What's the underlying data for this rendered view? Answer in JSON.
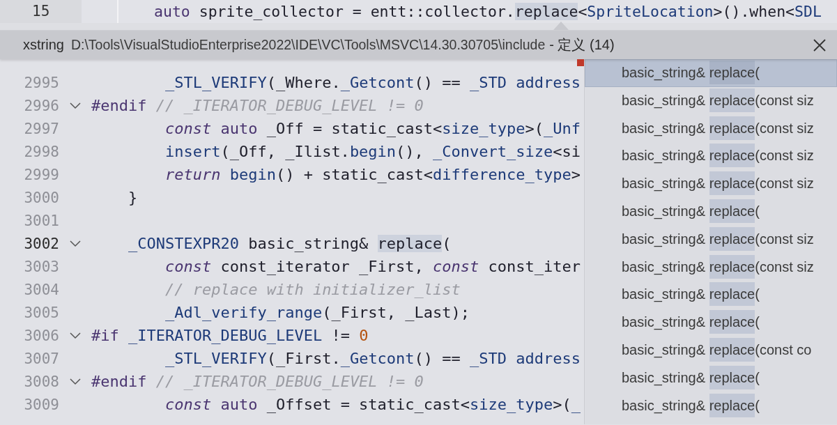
{
  "top_line": {
    "number": "15",
    "tokens": [
      {
        "text": "auto",
        "kind": "kw"
      },
      {
        "text": " sprite_collector = entt::collector.",
        "kind": "p"
      },
      {
        "text": "replace",
        "kind": "hl"
      },
      {
        "text": "<",
        "kind": "p"
      },
      {
        "text": "SpriteLocation",
        "kind": "id"
      },
      {
        "text": ">().when<",
        "kind": "p"
      },
      {
        "text": "SDL",
        "kind": "id"
      }
    ]
  },
  "peek_header": {
    "file_name": "xstring",
    "path": "D:\\Tools\\VisualStudioEnterprise2022\\IDE\\VC\\Tools\\MSVC\\14.30.30705\\include",
    "title": "- 定义 (14)"
  },
  "lines": [
    {
      "number": "2995",
      "fold": false,
      "current": false,
      "tokens": [
        {
          "text": "        _STL_VERIFY",
          "kind": "id"
        },
        {
          "text": "(_Where.",
          "kind": "p"
        },
        {
          "text": "_Getcont",
          "kind": "id"
        },
        {
          "text": "() == ",
          "kind": "p"
        },
        {
          "text": "_STD address",
          "kind": "id"
        }
      ]
    },
    {
      "number": "2996",
      "fold": true,
      "current": false,
      "tokens": [
        {
          "text": "#endif",
          "kind": "pp"
        },
        {
          "text": " // _ITERATOR_DEBUG_LEVEL != 0",
          "kind": "cm"
        }
      ]
    },
    {
      "number": "2997",
      "fold": false,
      "current": false,
      "tokens": [
        {
          "text": "        const",
          "kind": "kwi"
        },
        {
          "text": " auto",
          "kind": "kw"
        },
        {
          "text": " _Off = static_cast<",
          "kind": "p"
        },
        {
          "text": "size_type",
          "kind": "id"
        },
        {
          "text": ">(",
          "kind": "p"
        },
        {
          "text": "_Unf",
          "kind": "id"
        }
      ]
    },
    {
      "number": "2998",
      "fold": false,
      "current": false,
      "tokens": [
        {
          "text": "        insert",
          "kind": "id"
        },
        {
          "text": "(_Off, _Ilist.",
          "kind": "p"
        },
        {
          "text": "begin",
          "kind": "id"
        },
        {
          "text": "(), ",
          "kind": "p"
        },
        {
          "text": "_Convert_size",
          "kind": "id"
        },
        {
          "text": "<si",
          "kind": "p"
        }
      ]
    },
    {
      "number": "2999",
      "fold": false,
      "current": false,
      "tokens": [
        {
          "text": "        return",
          "kind": "kwi"
        },
        {
          "text": " begin",
          "kind": "id"
        },
        {
          "text": "() + static_cast<",
          "kind": "p"
        },
        {
          "text": "difference_type",
          "kind": "id"
        },
        {
          "text": ">",
          "kind": "p"
        }
      ]
    },
    {
      "number": "3000",
      "fold": false,
      "current": false,
      "tokens": [
        {
          "text": "    }",
          "kind": "p"
        }
      ]
    },
    {
      "number": "3001",
      "fold": false,
      "current": false
    },
    {
      "number": "3002",
      "fold": true,
      "current": true,
      "tokens": [
        {
          "text": "    _CONSTEXPR20",
          "kind": "id"
        },
        {
          "text": " basic_string& ",
          "kind": "p"
        },
        {
          "text": "replace",
          "kind": "hl"
        },
        {
          "text": "(",
          "kind": "p"
        }
      ]
    },
    {
      "number": "3003",
      "fold": false,
      "current": false,
      "tokens": [
        {
          "text": "        const",
          "kind": "kwi"
        },
        {
          "text": " const_iterator _First, ",
          "kind": "p"
        },
        {
          "text": "const",
          "kind": "kwi"
        },
        {
          "text": " const_iter",
          "kind": "p"
        }
      ]
    },
    {
      "number": "3004",
      "fold": false,
      "current": false,
      "tokens": [
        {
          "text": "        // replace with initializer_list",
          "kind": "cm"
        }
      ]
    },
    {
      "number": "3005",
      "fold": false,
      "current": false,
      "tokens": [
        {
          "text": "        _Adl_verify_range",
          "kind": "id"
        },
        {
          "text": "(_First, _Last);",
          "kind": "p"
        }
      ]
    },
    {
      "number": "3006",
      "fold": true,
      "current": false,
      "tokens": [
        {
          "text": "#if",
          "kind": "pp"
        },
        {
          "text": " _ITERATOR_DEBUG_LEVEL",
          "kind": "id"
        },
        {
          "text": " != ",
          "kind": "p"
        },
        {
          "text": "0",
          "kind": "num"
        }
      ]
    },
    {
      "number": "3007",
      "fold": false,
      "current": false,
      "tokens": [
        {
          "text": "        _STL_VERIFY",
          "kind": "id"
        },
        {
          "text": "(_First.",
          "kind": "p"
        },
        {
          "text": "_Getcont",
          "kind": "id"
        },
        {
          "text": "() == ",
          "kind": "p"
        },
        {
          "text": "_STD address",
          "kind": "id"
        }
      ]
    },
    {
      "number": "3008",
      "fold": true,
      "current": false,
      "tokens": [
        {
          "text": "#endif",
          "kind": "pp"
        },
        {
          "text": " // _ITERATOR_DEBUG_LEVEL != 0",
          "kind": "cm"
        }
      ]
    },
    {
      "number": "3009",
      "fold": false,
      "current": false,
      "tokens": [
        {
          "text": "        const",
          "kind": "kwi"
        },
        {
          "text": " auto",
          "kind": "kw"
        },
        {
          "text": " _Offset = static_cast<",
          "kind": "p"
        },
        {
          "text": "size_type",
          "kind": "id"
        },
        {
          "text": ">(",
          "kind": "p"
        },
        {
          "text": "_",
          "kind": "id"
        }
      ]
    }
  ],
  "results": [
    {
      "type": "basic_string&",
      "name": "replace",
      "params": "(",
      "selected": true
    },
    {
      "type": "basic_string&",
      "name": "replace",
      "params": "(const siz",
      "selected": false
    },
    {
      "type": "basic_string&",
      "name": "replace",
      "params": "(const siz",
      "selected": false
    },
    {
      "type": "basic_string&",
      "name": "replace",
      "params": "(const siz",
      "selected": false
    },
    {
      "type": "basic_string&",
      "name": "replace",
      "params": "(const siz",
      "selected": false
    },
    {
      "type": "basic_string&",
      "name": "replace",
      "params": "(",
      "selected": false
    },
    {
      "type": "basic_string&",
      "name": "replace",
      "params": "(const siz",
      "selected": false
    },
    {
      "type": "basic_string&",
      "name": "replace",
      "params": "(const siz",
      "selected": false
    },
    {
      "type": "basic_string&",
      "name": "replace",
      "params": "(",
      "selected": false
    },
    {
      "type": "basic_string&",
      "name": "replace",
      "params": "(",
      "selected": false
    },
    {
      "type": "basic_string&",
      "name": "replace",
      "params": "(const co",
      "selected": false
    },
    {
      "type": "basic_string&",
      "name": "replace",
      "params": "(",
      "selected": false
    },
    {
      "type": "basic_string&",
      "name": "replace",
      "params": "(",
      "selected": false
    }
  ]
}
